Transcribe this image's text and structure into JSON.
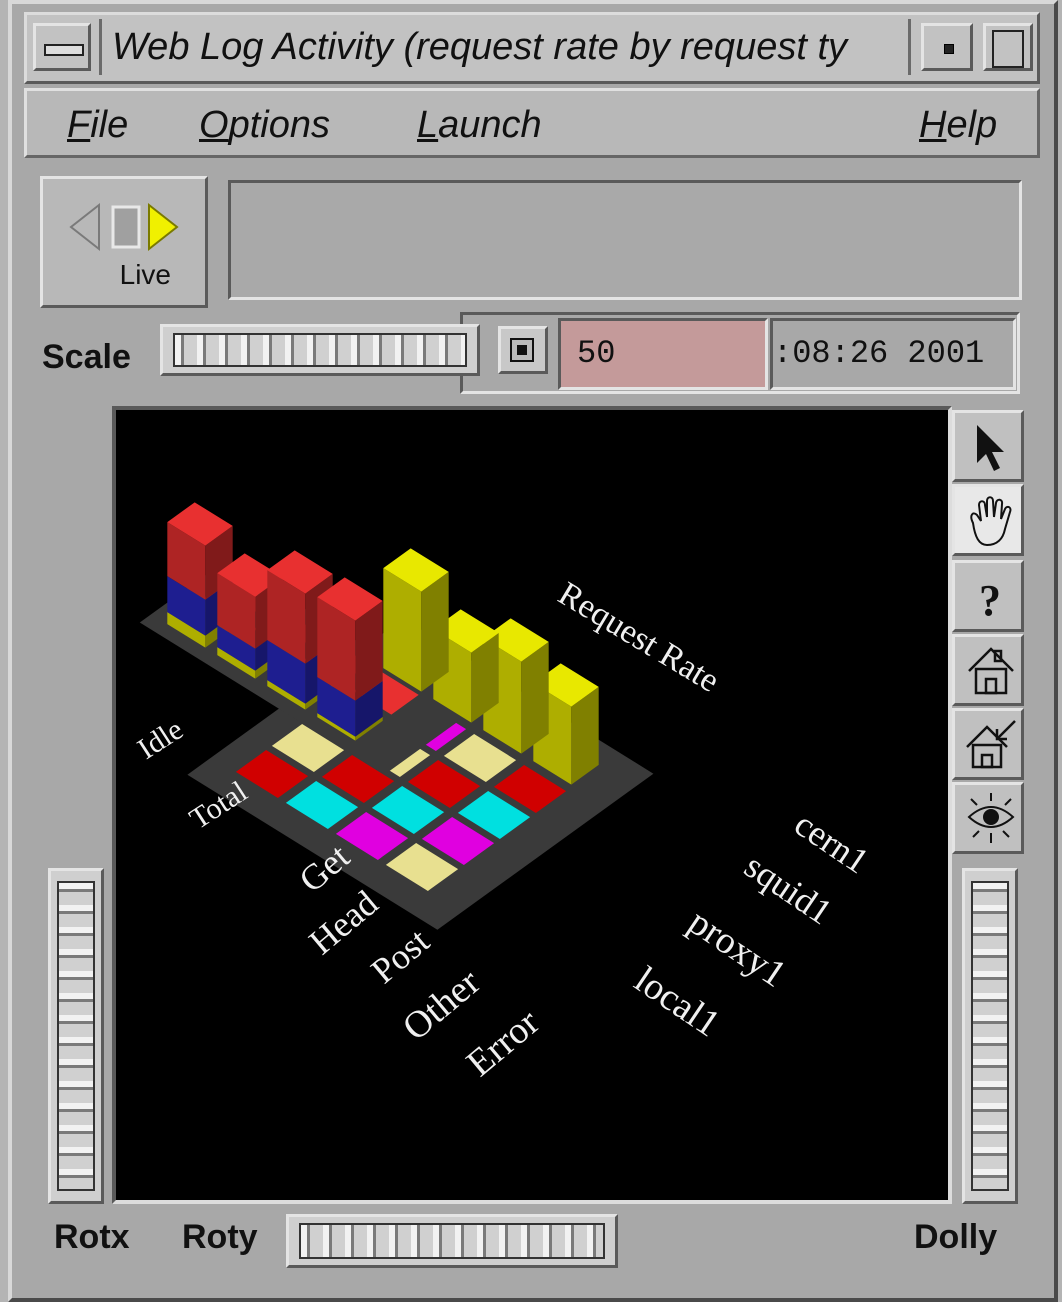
{
  "window": {
    "title": "Web Log Activity (request rate by request ty"
  },
  "menu": {
    "file": {
      "mnemonic": "F",
      "rest": "ile"
    },
    "options": {
      "mnemonic": "O",
      "rest": "ptions"
    },
    "launch": {
      "mnemonic": "L",
      "rest": "aunch"
    },
    "help": {
      "mnemonic": "H",
      "rest": "elp"
    }
  },
  "controls": {
    "live_label": "Live",
    "scale_label": "Scale",
    "interval_value": "50",
    "time_text": ":08:26 2001"
  },
  "scene": {
    "metric_label": "Request Rate",
    "summary_rows": [
      "Idle",
      "Total"
    ],
    "request_types": [
      "Get",
      "Head",
      "Post",
      "Other",
      "Error"
    ],
    "servers": [
      "cern1",
      "squid1",
      "proxy1",
      "local1"
    ],
    "colors": {
      "get": "#e8e800",
      "head": "#00e0e0",
      "post": "#e000e0",
      "other": "#e8e090",
      "error": "#d00000",
      "idle": "#e83030",
      "busy": "#2828c0"
    }
  },
  "bottom": {
    "rotx_label": "Rotx",
    "roty_label": "Roty",
    "dolly_label": "Dolly"
  },
  "tools": [
    "pointer-icon",
    "hand-icon",
    "help-icon",
    "home-icon",
    "set-home-icon",
    "view-all-icon"
  ]
}
